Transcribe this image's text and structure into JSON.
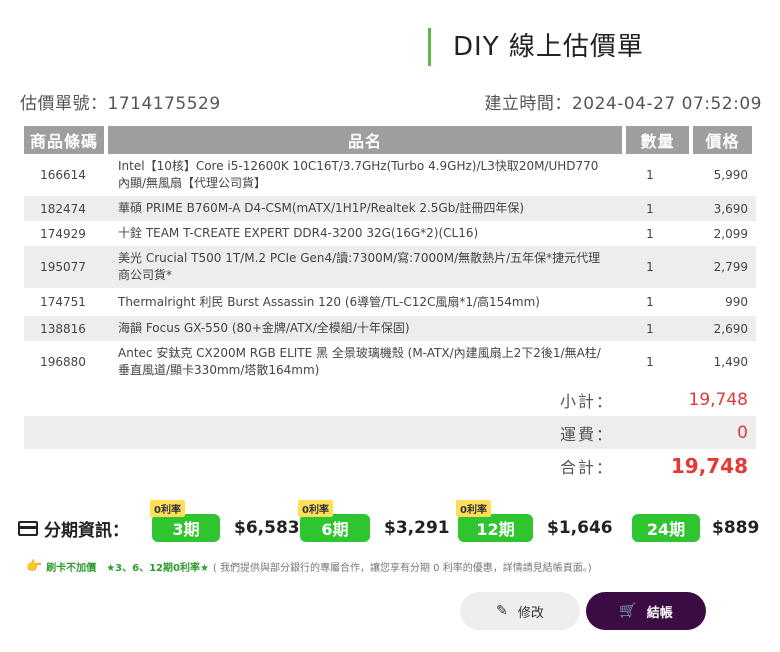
{
  "header": {
    "title": "DIY 線上估價單"
  },
  "meta": {
    "quote_no": "估價單號：1714175529",
    "created": "建立時間：2024-04-27 07:52:09"
  },
  "table": {
    "headers": {
      "code": "商品條碼",
      "name": "品名",
      "qty": "數量",
      "price": "價格"
    },
    "rows": [
      {
        "code": "166614",
        "name": "Intel【10核】Core i5-12600K 10C16T/3.7GHz(Turbo 4.9GHz)/L3快取20M/UHD770 內顯/無風扇【代理公司貨】",
        "qty": "1",
        "price": "5,990"
      },
      {
        "code": "182474",
        "name": "華碩 PRIME B760M-A D4-CSM(mATX/1H1P/Realtek 2.5Gb/註冊四年保)",
        "qty": "1",
        "price": "3,690"
      },
      {
        "code": "174929",
        "name": "十銓 TEAM T-CREATE EXPERT DDR4-3200 32G(16G*2)(CL16)",
        "qty": "1",
        "price": "2,099"
      },
      {
        "code": "195077",
        "name": "美光 Crucial T500 1T/M.2 PCIe Gen4/讀:7300M/寫:7000M/無散熱片/五年保*捷元代理商公司貨*",
        "qty": "1",
        "price": "2,799"
      },
      {
        "code": "174751",
        "name": "Thermalright 利民 Burst Assassin 120 (6導管/TL-C12C風扇*1/高154mm)",
        "qty": "1",
        "price": "990"
      },
      {
        "code": "138816",
        "name": "海韻 Focus GX-550 (80+金牌/ATX/全模組/十年保固)",
        "qty": "1",
        "price": "2,690"
      },
      {
        "code": "196880",
        "name": "Antec 安鈦克 CX200M RGB ELITE 黑 全景玻璃機殼 (M-ATX/內建風扇上2下2後1/無A柱/垂直風道/顯卡330mm/塔散164mm)",
        "qty": "1",
        "price": "1,490"
      }
    ]
  },
  "summary": {
    "subtotal_label": "小計：",
    "subtotal": "19,748",
    "shipping_label": "運費：",
    "shipping": "0",
    "total_label": "合計：",
    "total": "19,748"
  },
  "installments": {
    "label": "分期資訊：",
    "zero_tag": "0利率",
    "plans": [
      {
        "term": "3期",
        "amount": "$6,583",
        "zero": true
      },
      {
        "term": "6期",
        "amount": "$3,291",
        "zero": true
      },
      {
        "term": "12期",
        "amount": "$1,646",
        "zero": true
      },
      {
        "term": "24期",
        "amount": "$889",
        "zero": false
      }
    ]
  },
  "promo": {
    "hand_icon": "👉",
    "no_fee": "刷卡不加價",
    "zero_rate": "★3、6、12期0利率★",
    "note": "( 我們提供與部分銀行的專屬合作，讓您享有分期 0 利率的優惠，詳情請見結帳頁面。)"
  },
  "actions": {
    "edit_label": "修改",
    "checkout_label": "結帳"
  },
  "colors": {
    "accent": "#5fb84a",
    "price_red": "#e53935",
    "plan_green": "#2ec52e",
    "checkout_bg": "#3b0b44"
  }
}
